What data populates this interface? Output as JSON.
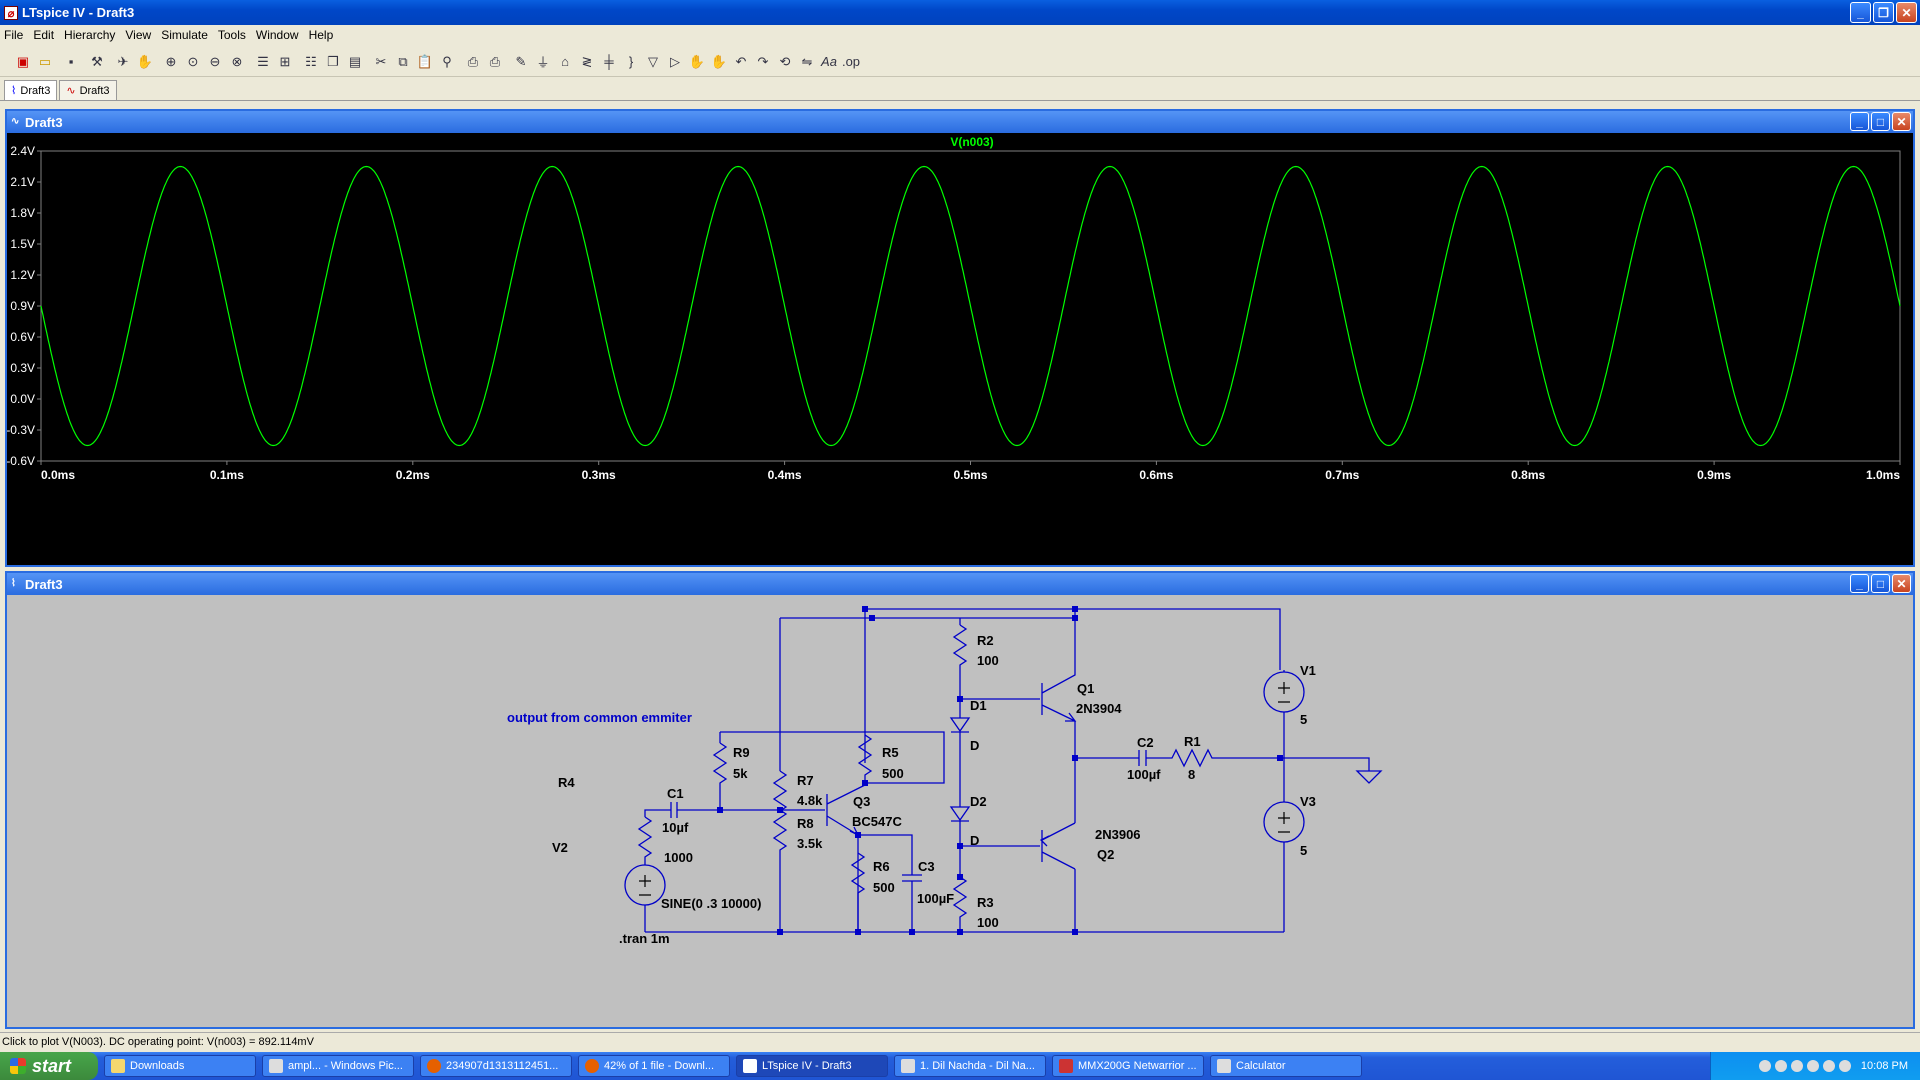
{
  "window": {
    "title": "LTspice IV - Draft3"
  },
  "menu": [
    "File",
    "Edit",
    "Hierarchy",
    "View",
    "Simulate",
    "Tools",
    "Window",
    "Help"
  ],
  "tabs": [
    {
      "label": "Draft3"
    },
    {
      "label": "Draft3"
    }
  ],
  "plot_window": {
    "title": "Draft3"
  },
  "schematic_window": {
    "title": "Draft3"
  },
  "chart_data": {
    "type": "line",
    "title": "V(n003)",
    "series": [
      {
        "name": "V(n003)",
        "color": "#00FF00"
      }
    ],
    "waveform": {
      "shape": "sine",
      "offset": 0.9,
      "amplitude": 1.35,
      "frequency_hz": 10000,
      "start_value": 0.9
    },
    "xlim": [
      0,
      1.0
    ],
    "ylim": [
      -0.6,
      2.4
    ],
    "x_ticks": [
      "0.0ms",
      "0.1ms",
      "0.2ms",
      "0.3ms",
      "0.4ms",
      "0.5ms",
      "0.6ms",
      "0.7ms",
      "0.8ms",
      "0.9ms",
      "1.0ms"
    ],
    "y_ticks": [
      "2.4V",
      "2.1V",
      "1.8V",
      "1.5V",
      "1.2V",
      "0.9V",
      "0.6V",
      "0.3V",
      "0.0V",
      "-0.3V",
      "-0.6V"
    ],
    "grid": false,
    "background": "#000000",
    "axis_color": "#808080",
    "tick_color": "#FFFFFF"
  },
  "schematic": {
    "wire_color": "#0000C8",
    "labels": {
      "output_note": "output from common emmiter",
      "r4": "R4",
      "v2": "V2",
      "c1": "C1",
      "c1v": "10µf",
      "r9": "R9",
      "r9v": "5k",
      "r7": "R7",
      "r7v": "4.8k",
      "r8": "R8",
      "r8v": "3.5k",
      "r5": "R5",
      "r5v": "500",
      "q3": "Q3",
      "q3v": "BC547C",
      "r6": "R6",
      "r6v": "500",
      "c3": "C3",
      "c3v": "100µF",
      "r2": "R2",
      "r2v": "100",
      "d1": "D1",
      "d1v": "D",
      "d2": "D2",
      "d2v": "D",
      "r3": "R3",
      "r3v": "100",
      "q1": "Q1",
      "q1v": "2N3904",
      "q2": "Q2",
      "q2v": "2N3906",
      "c2": "C2",
      "c2v": "100µf",
      "r1": "R1",
      "r1v": "8",
      "v1": "V1",
      "v1v": "5",
      "v3": "V3",
      "v3v": "5",
      "rv": "1000",
      "sine": "SINE(0 .3 10000)",
      "tran": ".tran 1m"
    }
  },
  "status": {
    "text": "Click to plot V(N003).  DC operating point: V(n003) = 892.114mV"
  },
  "taskbar": {
    "start": "start",
    "tasks": [
      "Downloads",
      "ampl... - Windows Pic...",
      "234907d1313112451...",
      "42% of 1 file - Downl...",
      "LTspice IV - Draft3",
      "1. Dil Nachda - Dil Na...",
      "MMX200G Netwarrior ...",
      "Calculator"
    ],
    "clock": "10:08 PM"
  }
}
